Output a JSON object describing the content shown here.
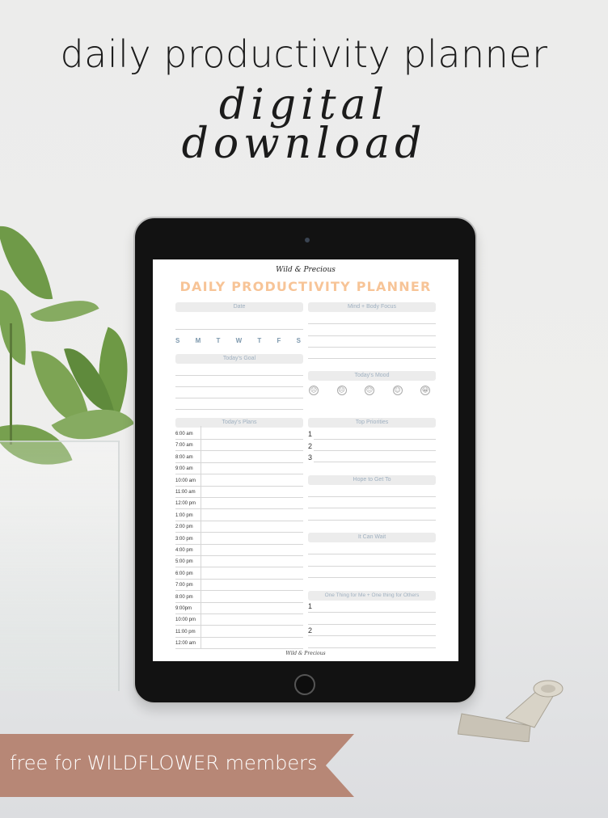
{
  "header": {
    "headline": "daily productivity planner",
    "script_line1": "digital",
    "script_line2": "download"
  },
  "banner": {
    "text": "free for WILDFLOWER members",
    "color": "#b78776"
  },
  "planner": {
    "brand": "Wild & Precious",
    "title": "DAILY PRODUCTIVITY PLANNER",
    "title_color": "#f7c497",
    "footer_brand": "Wild & Precious",
    "sections": {
      "date": "Date",
      "mind_body": "Mind + Body Focus",
      "goal": "Today's Goal",
      "mood": "Today's Mood",
      "plans": "Today's Plans",
      "priorities": "Top Priorities",
      "hope": "Hope to Get To",
      "wait": "It Can Wait",
      "one_thing": "One Thing for Me + One thing for Others"
    },
    "days": [
      "S",
      "M",
      "T",
      "W",
      "T",
      "F",
      "S"
    ],
    "moods": [
      "☹",
      "☹",
      "😐",
      "☺",
      "😀"
    ],
    "times": [
      "6:00 am",
      "7:00 am",
      "8:00 am",
      "9:00 am",
      "10:00 am",
      "11:00 am",
      "12:00 pm",
      "1:00 pm",
      "2:00 pm",
      "3:00 pm",
      "4:00 pm",
      "5:00 pm",
      "6:00 pm",
      "7:00 pm",
      "8:00 pm",
      "9:00pm",
      "10:00 pm",
      "11:00 pm",
      "12:00 am"
    ],
    "priority_numbers": [
      "1",
      "2",
      "3"
    ],
    "one_thing_numbers": [
      "1",
      "2"
    ]
  }
}
